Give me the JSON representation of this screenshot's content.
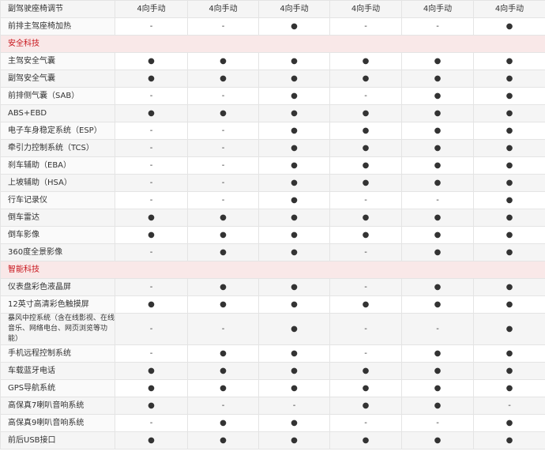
{
  "rows": [
    {
      "type": "row",
      "label": "副驾驶座椅调节",
      "values": [
        "4向手动",
        "4向手动",
        "4向手动",
        "4向手动",
        "4向手动",
        "4向手动"
      ]
    },
    {
      "type": "row",
      "label": "前排主驾座椅加热",
      "values": [
        "-",
        "-",
        "●",
        "-",
        "-",
        "●"
      ]
    },
    {
      "type": "section",
      "label": "安全科技"
    },
    {
      "type": "row",
      "label": "主驾安全气囊",
      "values": [
        "●",
        "●",
        "●",
        "●",
        "●",
        "●"
      ]
    },
    {
      "type": "row",
      "label": "副驾安全气囊",
      "values": [
        "●",
        "●",
        "●",
        "●",
        "●",
        "●"
      ]
    },
    {
      "type": "row",
      "label": "前排侧气囊（SAB）",
      "values": [
        "-",
        "-",
        "●",
        "-",
        "●",
        "●"
      ]
    },
    {
      "type": "row",
      "label": "ABS+EBD",
      "values": [
        "●",
        "●",
        "●",
        "●",
        "●",
        "●"
      ]
    },
    {
      "type": "row",
      "label": "电子车身稳定系统（ESP）",
      "values": [
        "-",
        "-",
        "●",
        "●",
        "●",
        "●"
      ]
    },
    {
      "type": "row",
      "label": "牵引力控制系统（TCS）",
      "values": [
        "-",
        "-",
        "●",
        "●",
        "●",
        "●"
      ]
    },
    {
      "type": "row",
      "label": "刹车辅助（EBA）",
      "values": [
        "-",
        "-",
        "●",
        "●",
        "●",
        "●"
      ]
    },
    {
      "type": "row",
      "label": "上坡辅助（HSA）",
      "values": [
        "-",
        "-",
        "●",
        "●",
        "●",
        "●"
      ]
    },
    {
      "type": "row",
      "label": "行车记录仪",
      "values": [
        "-",
        "-",
        "●",
        "-",
        "-",
        "●"
      ]
    },
    {
      "type": "row",
      "label": "倒车雷达",
      "values": [
        "●",
        "●",
        "●",
        "●",
        "●",
        "●"
      ]
    },
    {
      "type": "row",
      "label": "倒车影像",
      "values": [
        "●",
        "●",
        "●",
        "●",
        "●",
        "●"
      ]
    },
    {
      "type": "row",
      "label": "360度全景影像",
      "values": [
        "-",
        "●",
        "●",
        "-",
        "●",
        "●"
      ]
    },
    {
      "type": "section",
      "label": "智能科技"
    },
    {
      "type": "row",
      "label": "仪表盘彩色液晶屏",
      "values": [
        "-",
        "●",
        "●",
        "-",
        "●",
        "●"
      ]
    },
    {
      "type": "row",
      "label": "12英寸高清彩色触摸屏",
      "values": [
        "●",
        "●",
        "●",
        "●",
        "●",
        "●"
      ]
    },
    {
      "type": "row",
      "label": "暴风中控系统（含在线影视、在线音乐、网络电台、网页浏览等功能）",
      "values": [
        "-",
        "-",
        "●",
        "-",
        "-",
        "●"
      ],
      "tall": true
    },
    {
      "type": "row",
      "label": "手机远程控制系统",
      "values": [
        "-",
        "●",
        "●",
        "-",
        "●",
        "●"
      ]
    },
    {
      "type": "row",
      "label": "车载蓝牙电话",
      "values": [
        "●",
        "●",
        "●",
        "●",
        "●",
        "●"
      ]
    },
    {
      "type": "row",
      "label": "GPS导航系统",
      "values": [
        "●",
        "●",
        "●",
        "●",
        "●",
        "●"
      ]
    },
    {
      "type": "row",
      "label": "高保真7喇叭音响系统",
      "values": [
        "●",
        "-",
        "-",
        "●",
        "●",
        "-"
      ]
    },
    {
      "type": "row",
      "label": "高保真9喇叭音响系统",
      "values": [
        "-",
        "●",
        "●",
        "-",
        "-",
        "●"
      ]
    },
    {
      "type": "row",
      "label": "前后USB接口",
      "values": [
        "●",
        "●",
        "●",
        "●",
        "●",
        "●"
      ]
    }
  ]
}
